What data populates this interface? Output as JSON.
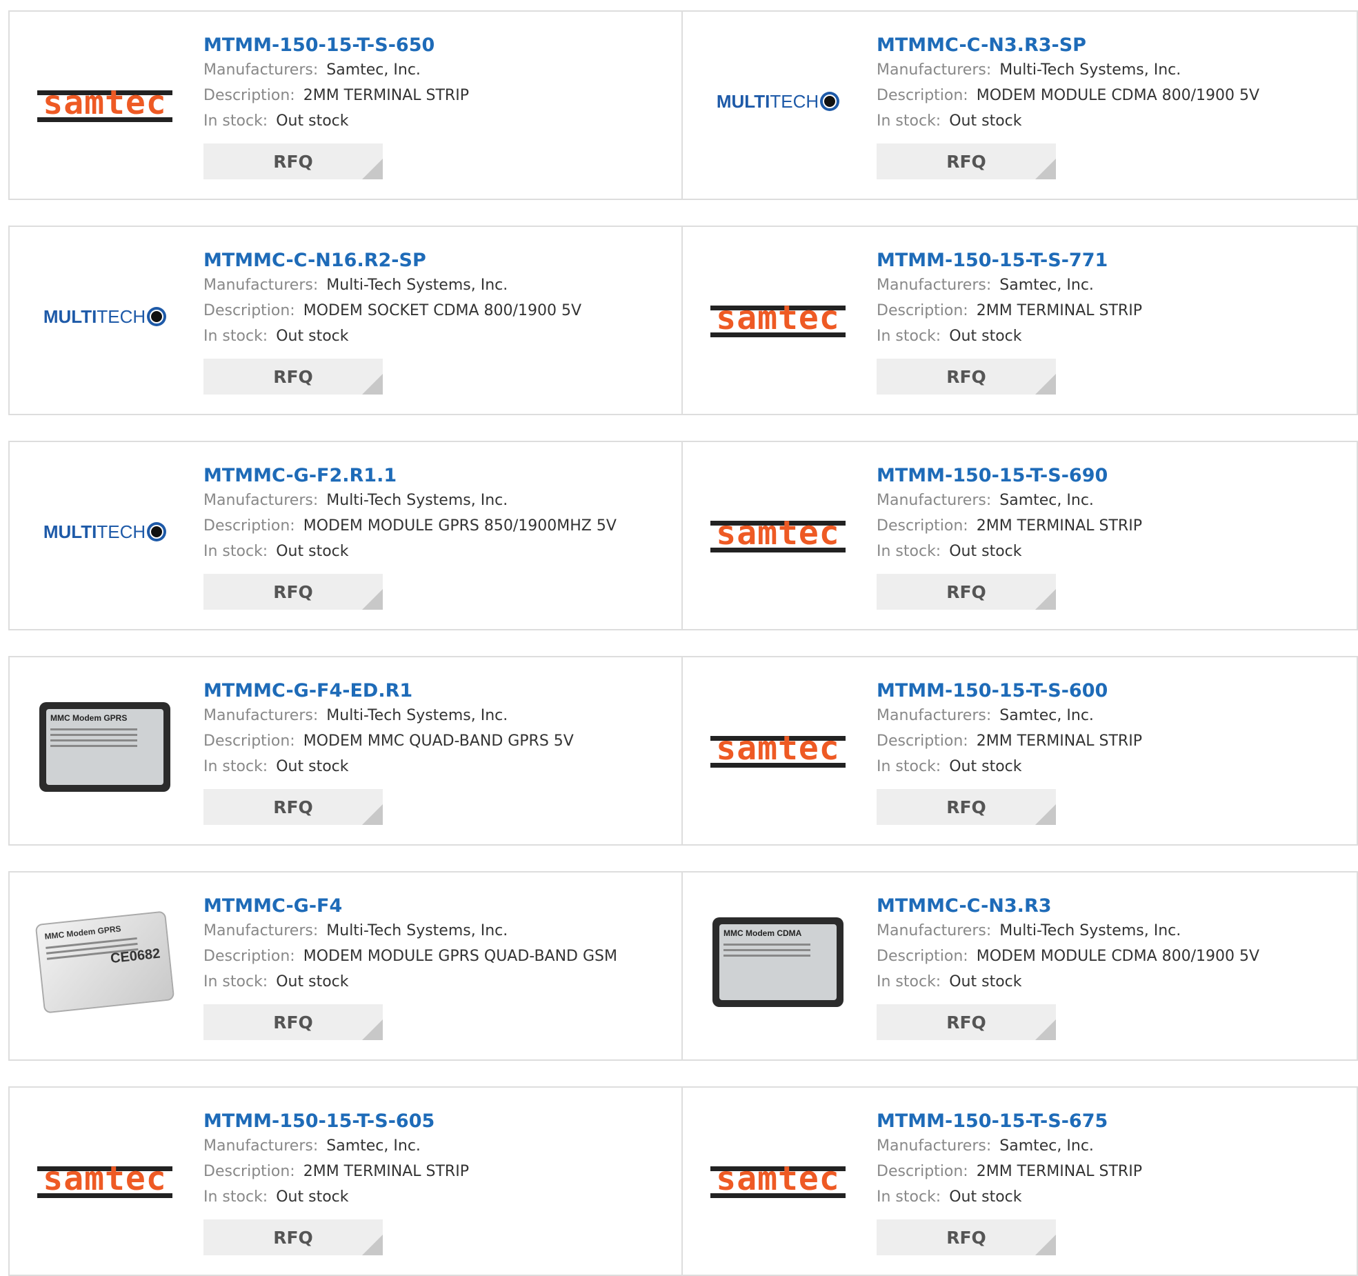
{
  "labels": {
    "manufacturers": "Manufacturers:",
    "description": "Description:",
    "in_stock": "In stock:",
    "rfq": "RFQ"
  },
  "logos": {
    "samtec": "samtec",
    "multitech_bold": "MULTI",
    "multitech_light": "TECH",
    "mmc_gprs": "MMC Modem GPRS",
    "mmc_cdma": "MMC Modem CDMA",
    "ce_mark": "CE0682"
  },
  "colors": {
    "title": "#1e6bb8",
    "samtec_orange": "#ee5a24",
    "multitech_blue": "#1e5aa8",
    "rfq_bg": "#eeeeee"
  },
  "products": [
    {
      "part": "MTMM-150-15-T-S-650",
      "manufacturer": "Samtec, Inc.",
      "description": "2MM TERMINAL STRIP",
      "stock": "Out stock",
      "logo": "samtec"
    },
    {
      "part": "MTMMC-C-N3.R3-SP",
      "manufacturer": "Multi-Tech Systems, Inc.",
      "description": "MODEM MODULE CDMA 800/1900 5V",
      "stock": "Out stock",
      "logo": "multitech"
    },
    {
      "part": "MTMMC-C-N16.R2-SP",
      "manufacturer": "Multi-Tech Systems, Inc.",
      "description": "MODEM SOCKET CDMA 800/1900 5V",
      "stock": "Out stock",
      "logo": "multitech"
    },
    {
      "part": "MTMM-150-15-T-S-771",
      "manufacturer": "Samtec, Inc.",
      "description": "2MM TERMINAL STRIP",
      "stock": "Out stock",
      "logo": "samtec"
    },
    {
      "part": "MTMMC-G-F2.R1.1",
      "manufacturer": "Multi-Tech Systems, Inc.",
      "description": "MODEM MODULE GPRS 850/1900MHZ 5V",
      "stock": "Out stock",
      "logo": "multitech"
    },
    {
      "part": "MTMM-150-15-T-S-690",
      "manufacturer": "Samtec, Inc.",
      "description": "2MM TERMINAL STRIP",
      "stock": "Out stock",
      "logo": "samtec"
    },
    {
      "part": "MTMMC-G-F4-ED.R1",
      "manufacturer": "Multi-Tech Systems, Inc.",
      "description": "MODEM MMC QUAD-BAND GPRS 5V",
      "stock": "Out stock",
      "logo": "modem-dark-gprs"
    },
    {
      "part": "MTMM-150-15-T-S-600",
      "manufacturer": "Samtec, Inc.",
      "description": "2MM TERMINAL STRIP",
      "stock": "Out stock",
      "logo": "samtec"
    },
    {
      "part": "MTMMC-G-F4",
      "manufacturer": "Multi-Tech Systems, Inc.",
      "description": "MODEM MODULE GPRS QUAD-BAND GSM",
      "stock": "Out stock",
      "logo": "modem-silver-gprs"
    },
    {
      "part": "MTMMC-C-N3.R3",
      "manufacturer": "Multi-Tech Systems, Inc.",
      "description": "MODEM MODULE CDMA 800/1900 5V",
      "stock": "Out stock",
      "logo": "modem-dark-cdma"
    },
    {
      "part": "MTMM-150-15-T-S-605",
      "manufacturer": "Samtec, Inc.",
      "description": "2MM TERMINAL STRIP",
      "stock": "Out stock",
      "logo": "samtec"
    },
    {
      "part": "MTMM-150-15-T-S-675",
      "manufacturer": "Samtec, Inc.",
      "description": "2MM TERMINAL STRIP",
      "stock": "Out stock",
      "logo": "samtec"
    }
  ]
}
